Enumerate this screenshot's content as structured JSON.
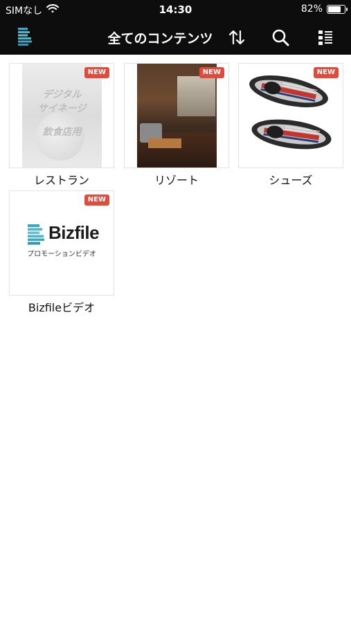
{
  "status_bar": {
    "carrier": "SIMなし",
    "time": "14:30",
    "battery_percent": "82%",
    "battery_level": 0.82
  },
  "nav": {
    "title": "全てのコンテンツ",
    "icons": [
      "logo-icon",
      "sort-icon",
      "search-icon",
      "list-view-icon"
    ]
  },
  "contents": [
    {
      "label": "レストラン",
      "badge": "NEW",
      "thumb_text": [
        "デジタル",
        "サイネージ",
        "飲食店用"
      ]
    },
    {
      "label": "リゾート",
      "badge": "NEW"
    },
    {
      "label": "シューズ",
      "badge": "NEW"
    },
    {
      "label": "Bizfileビデオ",
      "badge": "NEW",
      "thumb_brand": "Bizfile",
      "thumb_sub": "プロモーションビデオ"
    }
  ],
  "colors": {
    "bar_bg": "#0d0d0d",
    "badge_bg": "#e24b3b",
    "logo_teal": "#3aa7c4"
  }
}
